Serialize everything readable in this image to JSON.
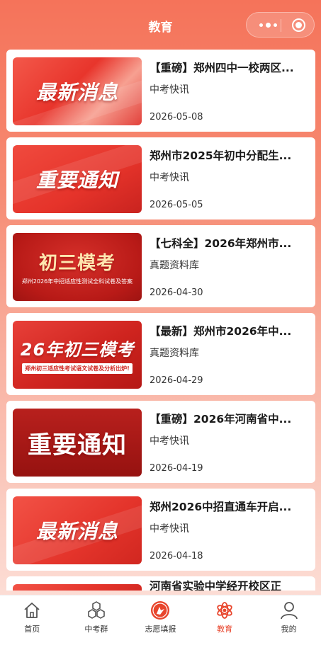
{
  "header": {
    "title": "教育"
  },
  "thumbs": {
    "latest": "最新消息",
    "notice": "重要通知",
    "mock1_title": "初三模考",
    "mock1_sub": "郑州2026年中招适应性测试全科试卷及答案",
    "mock2_title": "26年初三模考",
    "mock2_sub": "郑州初三适应性考试语文试卷及分析出炉!"
  },
  "articles": [
    {
      "title": "【重磅】郑州四中一校两区...",
      "category": "中考快讯",
      "date": "2026-05-08"
    },
    {
      "title": "郑州市2025年初中分配生...",
      "category": "中考快讯",
      "date": "2026-05-05"
    },
    {
      "title": "【七科全】2026年郑州市...",
      "category": "真题资料库",
      "date": "2026-04-30"
    },
    {
      "title": "【最新】郑州市2026年中...",
      "category": "真题资料库",
      "date": "2026-04-29"
    },
    {
      "title": "【重磅】2026年河南省中...",
      "category": "中考快讯",
      "date": "2026-04-19"
    },
    {
      "title": "郑州2026中招直通车开启...",
      "category": "中考快讯",
      "date": "2026-04-18"
    },
    {
      "title": "河南省实验中学经开校区正",
      "category": "",
      "date": ""
    }
  ],
  "tabbar": {
    "items": [
      {
        "label": "首页",
        "icon": "home-icon"
      },
      {
        "label": "中考群",
        "icon": "hexagon-group-icon"
      },
      {
        "label": "志愿填报",
        "icon": "fill-application-icon"
      },
      {
        "label": "教育",
        "icon": "atom-icon"
      },
      {
        "label": "我的",
        "icon": "user-icon"
      }
    ],
    "active": "教育"
  },
  "colors": {
    "accent": "#e8452c",
    "header_bg": "#f5735a"
  }
}
